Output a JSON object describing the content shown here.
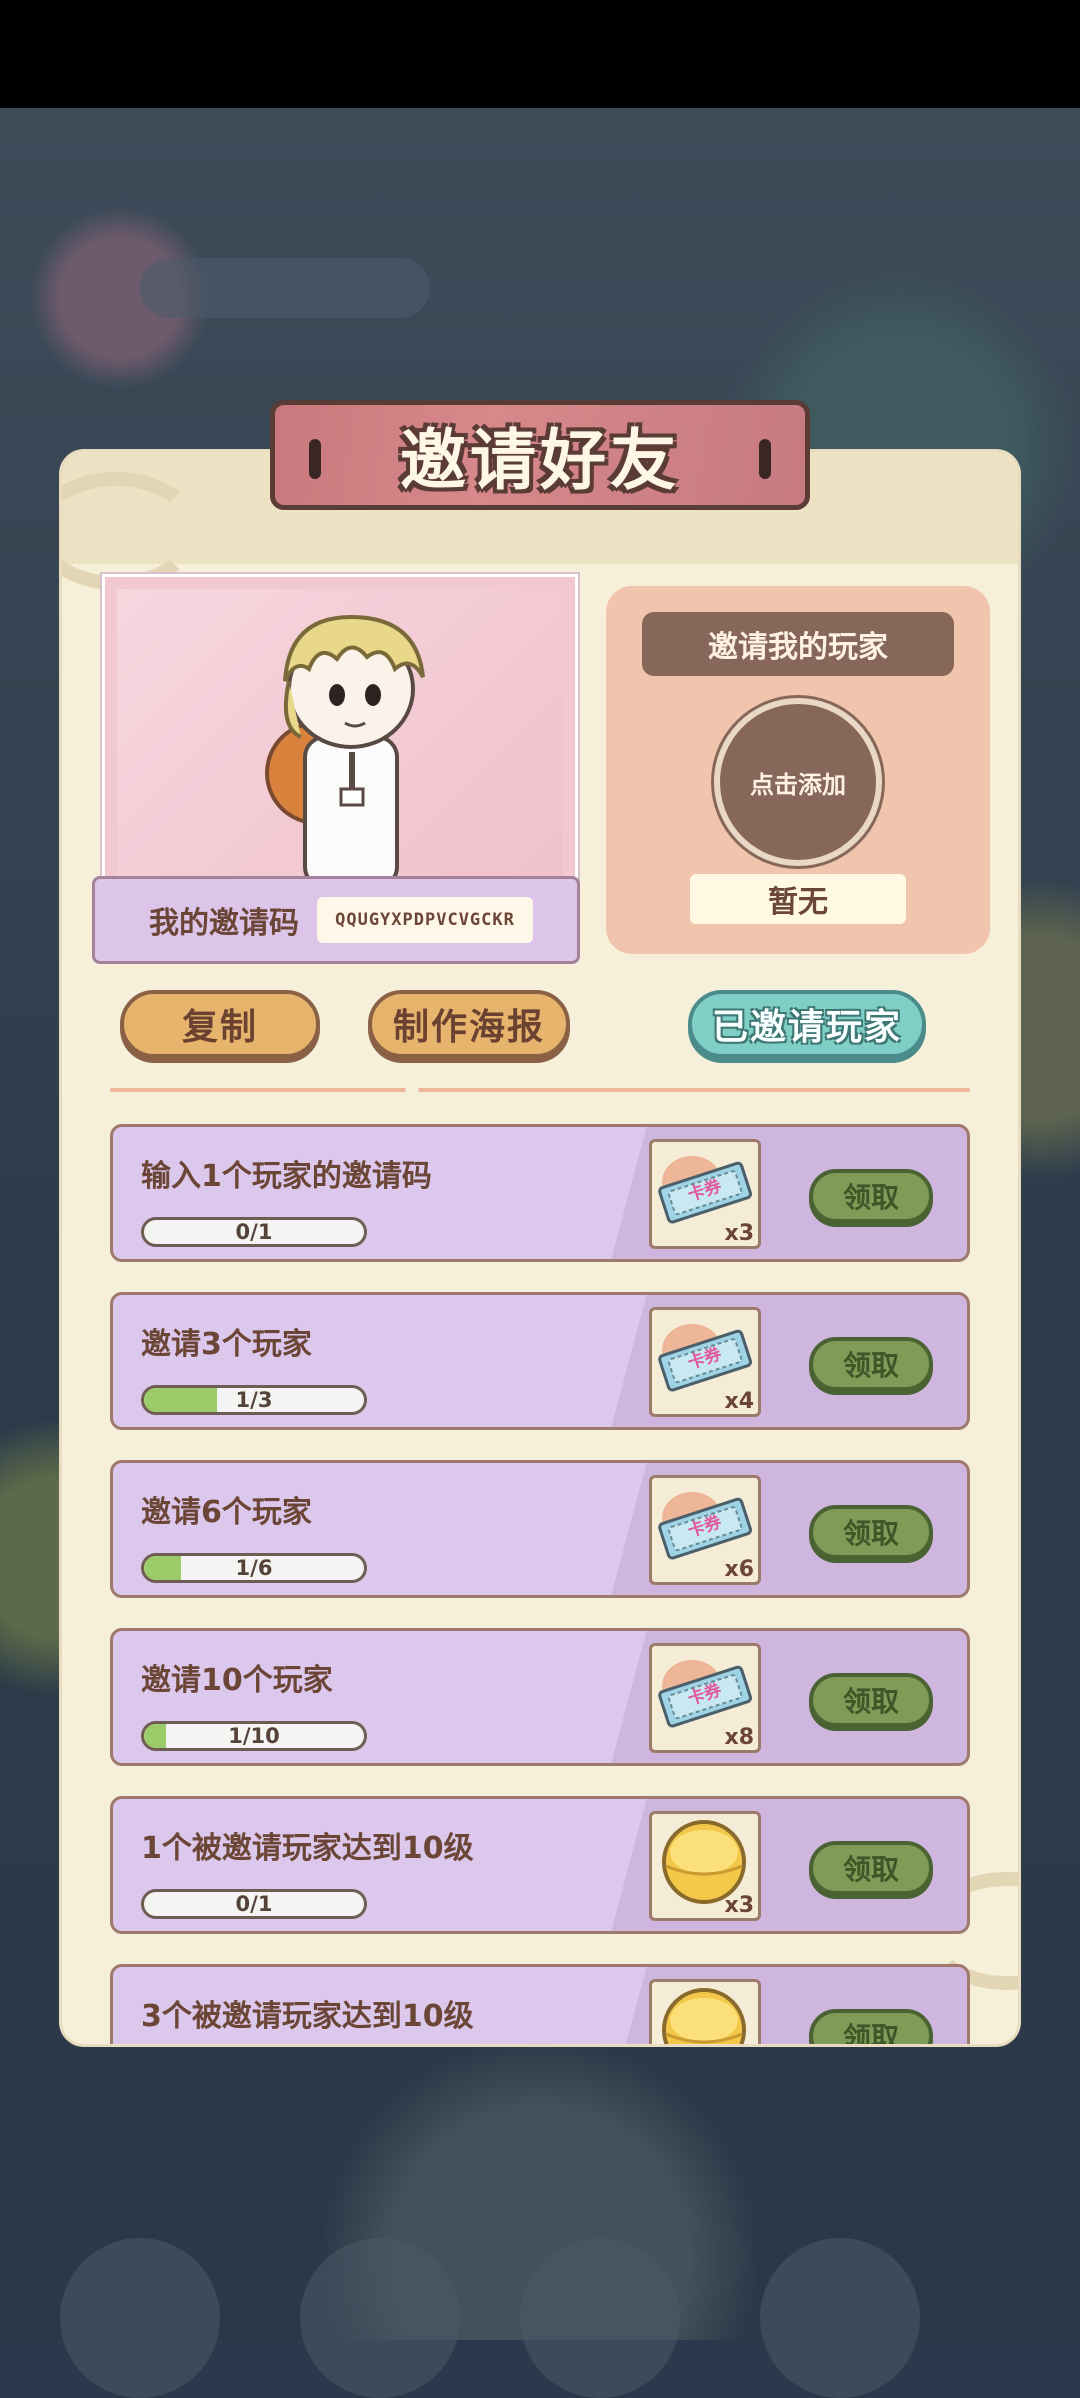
{
  "title": "邀请好友",
  "invite_code": {
    "label": "我的邀请码",
    "value": "QQUGYXPDPVCVGCKR"
  },
  "inviter": {
    "title": "邀请我的玩家",
    "add_label": "点击添加",
    "none_label": "暂无"
  },
  "buttons": {
    "copy": "复制",
    "poster": "制作海报",
    "invited": "已邀请玩家"
  },
  "tasks": [
    {
      "title": "输入1个玩家的邀请码",
      "progress_text": "0/1",
      "progress": 0.0,
      "reward_icon": "ticket-icon",
      "reward_text": "卡券",
      "reward_count": "x3",
      "claim": "领取"
    },
    {
      "title": "邀请3个玩家",
      "progress_text": "1/3",
      "progress": 0.333,
      "reward_icon": "ticket-icon",
      "reward_text": "卡券",
      "reward_count": "x4",
      "claim": "领取"
    },
    {
      "title": "邀请6个玩家",
      "progress_text": "1/6",
      "progress": 0.167,
      "reward_icon": "ticket-icon",
      "reward_text": "卡券",
      "reward_count": "x6",
      "claim": "领取"
    },
    {
      "title": "邀请10个玩家",
      "progress_text": "1/10",
      "progress": 0.1,
      "reward_icon": "ticket-icon",
      "reward_text": "卡券",
      "reward_count": "x8",
      "claim": "领取"
    },
    {
      "title": "1个被邀请玩家达到10级",
      "progress_text": "0/1",
      "progress": 0.0,
      "reward_icon": "gold-ball-icon",
      "reward_count": "x3",
      "claim": "领取"
    },
    {
      "title": "3个被邀请玩家达到10级",
      "progress_text": "",
      "progress": 0.0,
      "reward_icon": "gold-ball-icon",
      "reward_count": "",
      "claim": "领取"
    }
  ],
  "colors": {
    "panel": "#f6efd9",
    "banner": "#c9797d",
    "task_bg": "#dcc8ec",
    "claim_btn": "#7f9b58",
    "progress_fill": "#9bcc68"
  }
}
